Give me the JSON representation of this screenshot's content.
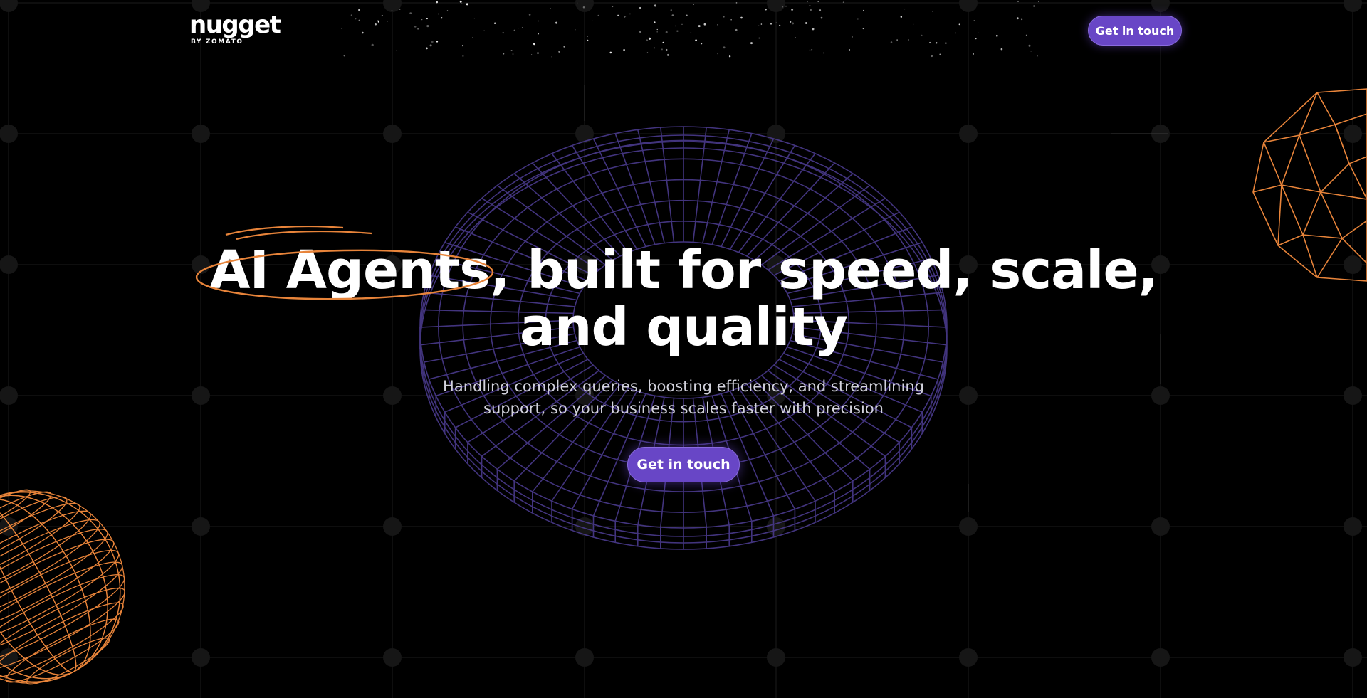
{
  "brand": {
    "name": "nugget",
    "byline": "BY ZOMATO"
  },
  "nav": {
    "cta_label": "Get in touch"
  },
  "hero": {
    "headline_highlight": "AI Agents",
    "headline_rest": ", built for speed, scale,",
    "headline_line2": "and quality",
    "subheading": "Handling complex queries, boosting efficiency, and streamlining support, so your business scales faster with precision",
    "cta_label": "Get in touch"
  },
  "colors": {
    "background": "#000000",
    "accent_purple": "#6846c6",
    "accent_orange": "#e8843a",
    "wireframe_purple": "#4a3a8c"
  },
  "icons": [
    "torus-wireframe-icon",
    "geodesic-sphere-icon",
    "globe-wireframe-icon",
    "scribble-highlight-icon"
  ]
}
